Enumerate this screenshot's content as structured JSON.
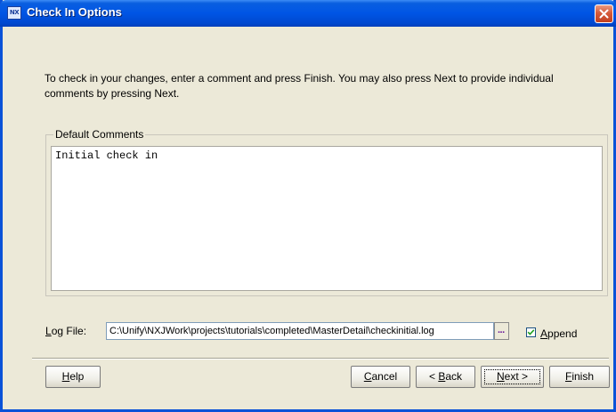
{
  "window": {
    "title": "Check In Options",
    "icon_text": "NX",
    "accent_color": "#0055e5",
    "close_color": "#c2401f"
  },
  "instructions": "To check in your changes, enter a comment and press Finish. You may also press Next to provide individual comments by pressing Next.",
  "comments": {
    "group_label": "Default Comments",
    "value": "Initial check in"
  },
  "log_file": {
    "label_mnemonic": "L",
    "label_rest": "og File:",
    "value": "C:\\Unify\\NXJWork\\projects\\tutorials\\completed\\MasterDetail\\checkinitial.log",
    "browse_label": "...",
    "append_mnemonic": "A",
    "append_rest": "ppend",
    "append_checked": true
  },
  "buttons": {
    "help_mnemonic": "H",
    "help_rest": "elp",
    "cancel_mnemonic": "C",
    "cancel_rest": "ancel",
    "back_prefix": "< ",
    "back_mnemonic": "B",
    "back_rest": "ack",
    "next_mnemonic": "N",
    "next_rest": "ext >",
    "finish_mnemonic": "F",
    "finish_rest": "inish"
  }
}
